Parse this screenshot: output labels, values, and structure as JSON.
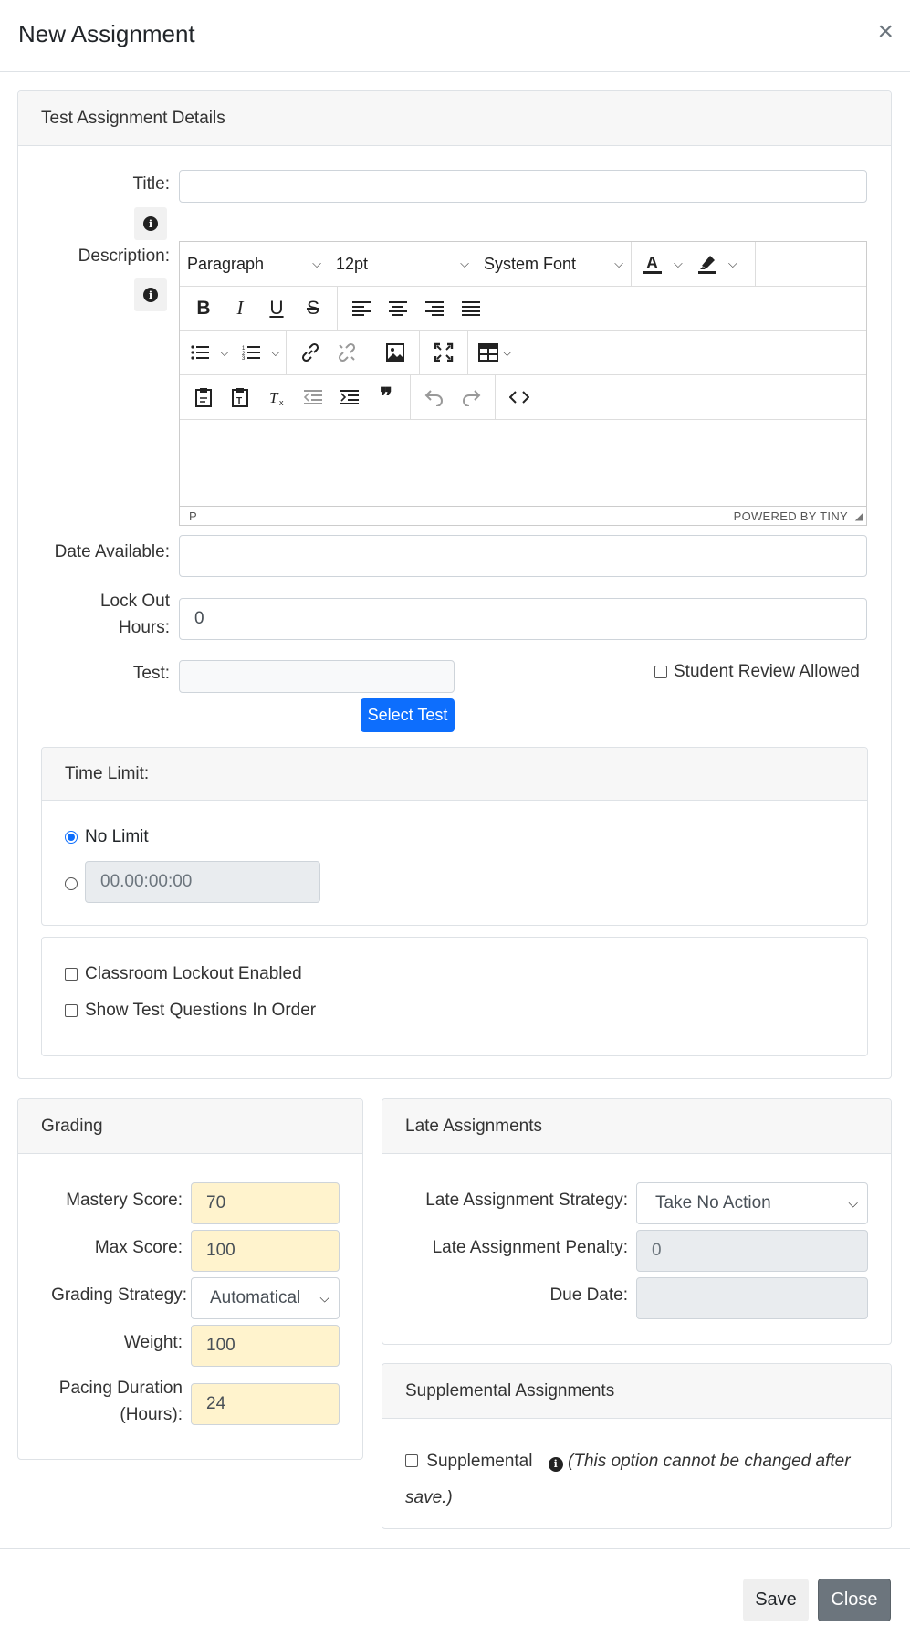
{
  "modal": {
    "title": "New Assignment",
    "close_glyph": "×"
  },
  "details": {
    "header": "Test Assignment Details",
    "title_label": "Title:",
    "title_value": "",
    "description_label": "Description:",
    "editor": {
      "block_format": "Paragraph",
      "font_size": "12pt",
      "font_family": "System Font",
      "status_path": "P",
      "branding": "POWERED BY TINY"
    },
    "date_available_label": "Date Available:",
    "date_available_value": "",
    "lockout_label_line1": "Lock Out",
    "lockout_label_line2": "Hours:",
    "lockout_value": "0",
    "test_label": "Test:",
    "test_value": "",
    "select_test_button": "Select Test",
    "student_review_label": "Student Review Allowed"
  },
  "time_limit": {
    "header": "Time Limit:",
    "no_limit_label": "No Limit",
    "time_placeholder": "00.00:00:00"
  },
  "options": {
    "classroom_lockout_label": "Classroom Lockout Enabled",
    "show_in_order_label": "Show Test Questions In Order"
  },
  "grading": {
    "header": "Grading",
    "mastery_label": "Mastery Score:",
    "mastery_value": "70",
    "max_label": "Max Score:",
    "max_value": "100",
    "strategy_label": "Grading Strategy:",
    "strategy_value": "Automatical",
    "weight_label": "Weight:",
    "weight_value": "100",
    "pacing_label_line1": "Pacing Duration",
    "pacing_label_line2": "(Hours):",
    "pacing_value": "24"
  },
  "late": {
    "header": "Late Assignments",
    "strategy_label": "Late Assignment Strategy:",
    "strategy_value": "Take No Action",
    "penalty_label": "Late Assignment Penalty:",
    "penalty_value": "0",
    "due_date_label": "Due Date:",
    "due_date_value": ""
  },
  "supplemental": {
    "header": "Supplemental Assignments",
    "checkbox_label": "Supplemental",
    "note_line1": "(This option cannot be changed after",
    "note_line2": "save.)"
  },
  "footer": {
    "save_label": "Save",
    "close_label": "Close"
  },
  "colors": {
    "primary": "#0d6efd",
    "secondary": "#6c757d",
    "highlight_input": "#fff3cd"
  }
}
